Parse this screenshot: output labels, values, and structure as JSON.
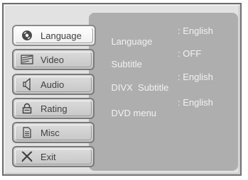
{
  "menu": {
    "items": [
      {
        "label": "Language",
        "icon": "disc-icon",
        "active": true
      },
      {
        "label": "Video",
        "icon": "monitor-icon",
        "active": false
      },
      {
        "label": "Audio",
        "icon": "speaker-icon",
        "active": false
      },
      {
        "label": "Rating",
        "icon": "lock-icon",
        "active": false
      },
      {
        "label": "Misc",
        "icon": "document-icon",
        "active": false
      },
      {
        "label": "Exit",
        "icon": "close-icon",
        "active": false
      }
    ]
  },
  "settings": {
    "rows": [
      {
        "key": "Language",
        "value": ": English"
      },
      {
        "key": "Subtitle",
        "value": ": OFF"
      },
      {
        "key": "DIVX  Subtitle",
        "value": ": English"
      },
      {
        "key": "DVD menu",
        "value": ": English"
      }
    ]
  },
  "colors": {
    "panel": "#aeaeae",
    "frame": "#e2e2e2",
    "text_light": "#f2f2f2",
    "text_dark": "#404040"
  }
}
